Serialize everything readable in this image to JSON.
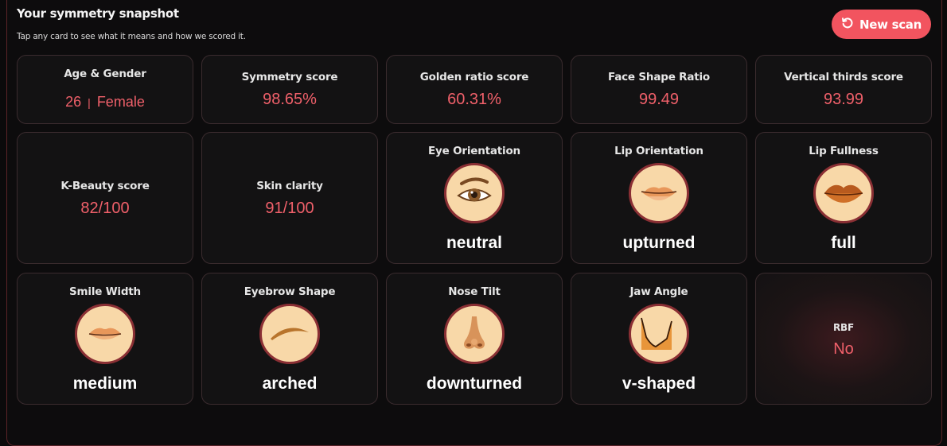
{
  "header": {
    "title": "Your symmetry snapshot",
    "subtitle": "Tap any card to see what it means and how we scored it.",
    "new_scan_label": "New scan"
  },
  "cards": {
    "age_gender": {
      "label": "Age & Gender",
      "age": "26",
      "separator": "|",
      "gender": "Female"
    },
    "symmetry": {
      "label": "Symmetry score",
      "value": "98.65%"
    },
    "golden_ratio": {
      "label": "Golden ratio score",
      "value": "60.31%"
    },
    "face_shape": {
      "label": "Face Shape Ratio",
      "value": "99.49"
    },
    "vertical_thirds": {
      "label": "Vertical thirds score",
      "value": "93.99"
    },
    "kbeauty": {
      "label": "K-Beauty score",
      "value": "82/100"
    },
    "skin": {
      "label": "Skin clarity",
      "value": "91/100"
    },
    "eye_orientation": {
      "label": "Eye Orientation",
      "value": "neutral",
      "icon": "eye-icon"
    },
    "lip_orientation": {
      "label": "Lip Orientation",
      "value": "upturned",
      "icon": "lips-upturned-icon"
    },
    "lip_fullness": {
      "label": "Lip Fullness",
      "value": "full",
      "icon": "lips-full-icon"
    },
    "smile_width": {
      "label": "Smile Width",
      "value": "medium",
      "icon": "lips-icon"
    },
    "eyebrow_shape": {
      "label": "Eyebrow Shape",
      "value": "arched",
      "icon": "eyebrow-icon"
    },
    "nose_tilt": {
      "label": "Nose Tilt",
      "value": "downturned",
      "icon": "nose-icon"
    },
    "jaw_angle": {
      "label": "Jaw Angle",
      "value": "v-shaped",
      "icon": "jaw-icon"
    },
    "rbf": {
      "label": "RBF",
      "value": "No"
    }
  },
  "colors": {
    "accent": "#f2545f",
    "value_text": "#f0606a",
    "card_bg": "#131213",
    "icon_bg": "#f8d8a8",
    "icon_border": "#8a2f34"
  }
}
